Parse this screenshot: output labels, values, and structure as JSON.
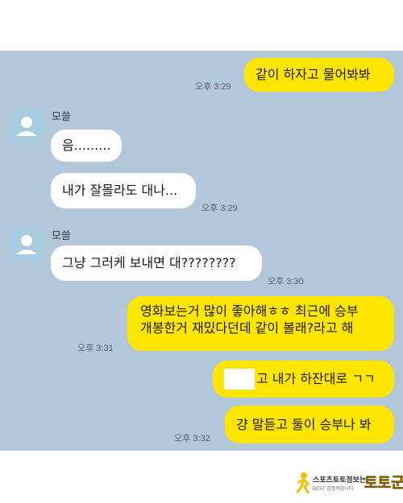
{
  "contact": {
    "name": "모쓸"
  },
  "messages": [
    {
      "id": "m1",
      "sender": "me",
      "text": "같이 하자고 물어봐봐",
      "time": "오후 3:29"
    },
    {
      "id": "m2",
      "sender": "other",
      "text": "음.........",
      "time": ""
    },
    {
      "id": "m3",
      "sender": "other",
      "text": "내가 잘몰라도 대나...",
      "time": "오후 3:29"
    },
    {
      "id": "m4",
      "sender": "other",
      "text": "그냥 그러케 보내면 대????????",
      "time": "오후 3:30"
    },
    {
      "id": "m5",
      "sender": "me",
      "line1": "영화보는거 많이 좋아해ㅎㅎ 최근에 승부",
      "line2": "개봉한거 재밌다던데 같이 볼래?라고 해",
      "time": "오후 3:31"
    },
    {
      "id": "m6",
      "sender": "me",
      "text": "고 내가 하잔대로 ㄱㄱ",
      "time": ""
    },
    {
      "id": "m7",
      "sender": "me",
      "text": "걍 말듣고 둘이 승부나 봐",
      "time": "오후 3:32"
    }
  ],
  "watermark": {
    "line1": "스포츠토토",
    "line1b": "정보는",
    "line2": "BEST 검증커뮤니티",
    "brand": "토토군"
  },
  "colors": {
    "chat_background": "#b2c7da",
    "outgoing_bubble": "#fee500",
    "incoming_bubble": "#ffffff",
    "avatar": "#a7ccdf"
  }
}
